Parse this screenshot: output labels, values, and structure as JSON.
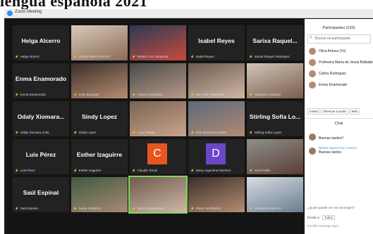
{
  "banner": "lengua española 2021",
  "window": {
    "title": "Zoom Meeting"
  },
  "tiles": [
    {
      "name": "Helga Alcerro",
      "caption": "Helga Alcerro",
      "kind": "name"
    },
    {
      "caption": "Lesbia Isabel Sánchez",
      "kind": "photo",
      "photo": "p1"
    },
    {
      "caption": "Rafael Cruz Sandoval",
      "kind": "photo",
      "photo": "p2"
    },
    {
      "name": "Isabel Reyes",
      "caption": "Isabel Reyes",
      "kind": "name"
    },
    {
      "name": "Sarixa Raquel...",
      "caption": "Sarixa Raquel Velásquez",
      "kind": "name"
    },
    {
      "name": "Enma Enamorado",
      "caption": "Enma Enamorado",
      "kind": "name"
    },
    {
      "caption": "Kelly Banegas",
      "kind": "photo",
      "photo": "p3"
    },
    {
      "caption": "Ariana Fernández",
      "kind": "photo",
      "photo": "p4"
    },
    {
      "caption": "Ilsa Ruth Valladares",
      "kind": "photo",
      "photo": "p5"
    },
    {
      "caption": "Alejandra Carbajal",
      "kind": "photo",
      "photo": "p6"
    },
    {
      "name": "Odaly Xiomara...",
      "caption": "Odaly Xiomara Ávila",
      "kind": "name"
    },
    {
      "name": "Sindy Lopez",
      "caption": "Sindy Lopez",
      "kind": "name"
    },
    {
      "caption": "Lucy Ortega",
      "kind": "photo",
      "photo": "p7"
    },
    {
      "caption": "Elsa Marina González",
      "kind": "photo",
      "photo": "p8"
    },
    {
      "name": "Stirling Sofia Lo...",
      "caption": "Stirling Sofia Lopez",
      "kind": "name"
    },
    {
      "name": "Luis Pérez",
      "caption": "Luis Pérez",
      "kind": "name"
    },
    {
      "name": "Esther Izaguirre",
      "caption": "Esther Izaguirre",
      "kind": "name"
    },
    {
      "caption": "Claudia Teruel",
      "kind": "letter",
      "letter": "C",
      "color": "#e8561f"
    },
    {
      "caption": "Deisy Argentina Ramírez",
      "kind": "letter",
      "letter": "D",
      "color": "#6b47c7"
    },
    {
      "caption": "Ana Portillo",
      "kind": "photo",
      "photo": "p9"
    },
    {
      "name": "Saúl Espinal",
      "caption": "Saúl Espinal",
      "kind": "name"
    },
    {
      "caption": "Nubia Gutiérrez",
      "kind": "photo",
      "photo": "p10"
    },
    {
      "caption": "Néstor Baquedano",
      "kind": "photo",
      "photo": "p5",
      "active": true
    },
    {
      "caption": "Silvia Castellanos",
      "kind": "photo",
      "photo": "p3"
    },
    {
      "caption": "Alexandra Martínez",
      "kind": "photo",
      "photo": "p11"
    }
  ],
  "participants": {
    "header": "Participantes (120)",
    "search_placeholder": "Buscar un participante",
    "list": [
      {
        "name": "Oliva Antuca (Yo)"
      },
      {
        "name": "Profesora María de Jesús Balladares"
      },
      {
        "name": "Carlos Rodríguez"
      },
      {
        "name": "Enma Enamorado"
      }
    ],
    "buttons": [
      "Invitar",
      "Silenciar a todos",
      "Más"
    ]
  },
  "chat": {
    "header": "Chat",
    "messages": [
      {
        "from": "",
        "text": "Buenas tardes!!"
      },
      {
        "from": "Néstor Hazel Cruz Lorenzo",
        "text": "Buenas tardes"
      }
    ],
    "input_hint": "¿Quién puede ver sus mensajes?",
    "to_label": "Enviar a:",
    "to_value": "Todos",
    "compose_placeholder": "Escribir mensaje aquí..."
  }
}
